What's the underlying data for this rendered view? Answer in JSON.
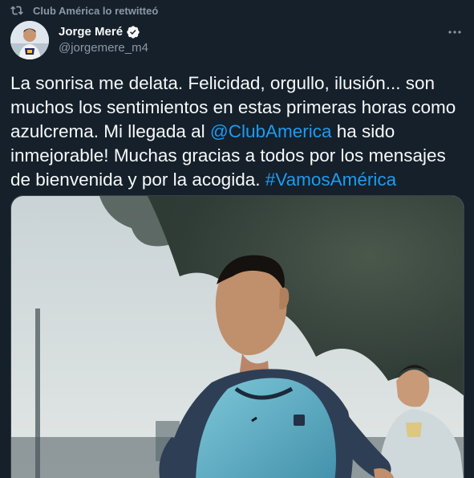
{
  "retweet": {
    "label": "Club América lo retwitteó"
  },
  "author": {
    "name": "Jorge Meré",
    "handle": "@jorgemere_m4",
    "verified": true
  },
  "tweet": {
    "text_before_mention": "La sonrisa me delata. Felicidad, orgullo, ilusión... son muchos los sentimientos en estas primeras horas como azulcrema. Mi llegada al ",
    "mention": "@ClubAmerica",
    "text_after_mention": " ha sido inmejorable! Muchas gracias a todos por los mensajes de bienvenida y por la acogida. ",
    "hashtag": "#VamosAmérica"
  },
  "colors": {
    "background": "#15202b",
    "text": "#f7f9f9",
    "secondary": "#8b98a5",
    "link": "#1d9bf0",
    "verified": "#f7f9f9"
  },
  "icons": {
    "retweet": "retweet-icon",
    "verified": "verified-badge-icon",
    "more": "more-options-icon"
  }
}
